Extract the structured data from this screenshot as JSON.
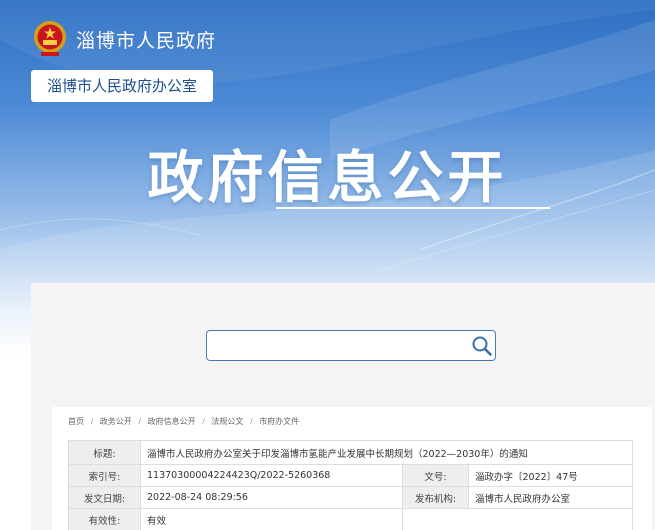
{
  "header": {
    "site_name": "淄博市人民政府",
    "dept_tag": "淄博市人民政府办公室",
    "hero_title": "政府信息公开"
  },
  "search": {
    "placeholder": "",
    "value": ""
  },
  "breadcrumb": [
    "首页",
    "政务公开",
    "政府信息公开",
    "法规公文",
    "市府办文件"
  ],
  "breadcrumb_sep": "/",
  "meta": {
    "title_label": "标题:",
    "title_value": "淄博市人民政府办公室关于印发淄博市氢能产业发展中长期规划（2022—2030年）的通知",
    "index_label": "索引号:",
    "index_value": "11370300004224423Q/2022-5260368",
    "doc_no_label": "文号:",
    "doc_no_value": "淄政办字〔2022〕47号",
    "date_label": "发文日期:",
    "date_value": "2022-08-24 08:29:56",
    "org_label": "发布机构:",
    "org_value": "淄博市人民政府办公室",
    "validity_label": "有效性:",
    "validity_value": "有效"
  },
  "colors": {
    "banner_top": "#2e6fc2",
    "link_blue": "#1d4f93",
    "panel_bg": "#f4f4f4"
  },
  "icons": {
    "emblem": "national-emblem-icon",
    "search": "search-icon"
  }
}
